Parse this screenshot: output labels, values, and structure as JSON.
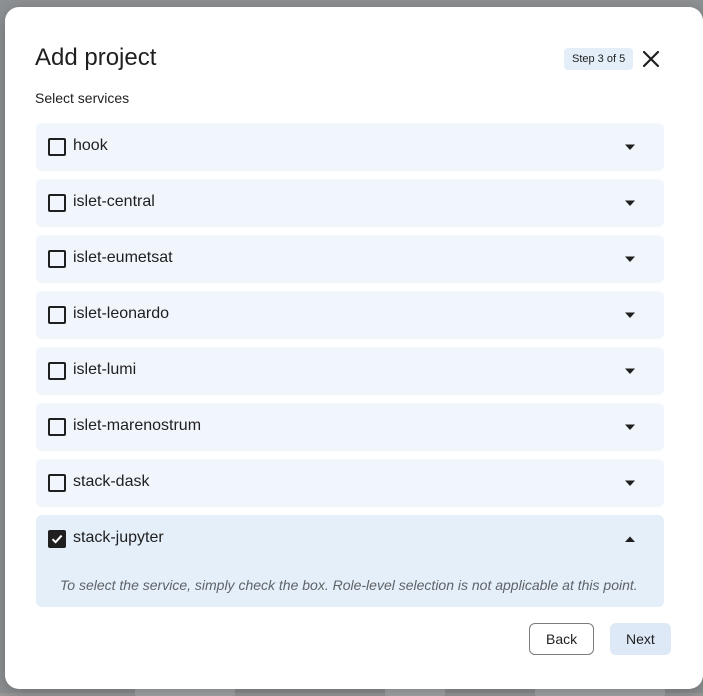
{
  "dialog": {
    "title": "Add project",
    "step": "Step 3 of 5",
    "subtitle": "Select services"
  },
  "services": [
    {
      "label": "hook",
      "checked": false,
      "expanded": false
    },
    {
      "label": "islet-central",
      "checked": false,
      "expanded": false
    },
    {
      "label": "islet-eumetsat",
      "checked": false,
      "expanded": false
    },
    {
      "label": "islet-leonardo",
      "checked": false,
      "expanded": false
    },
    {
      "label": "islet-lumi",
      "checked": false,
      "expanded": false
    },
    {
      "label": "islet-marenostrum",
      "checked": false,
      "expanded": false
    },
    {
      "label": "stack-dask",
      "checked": false,
      "expanded": false
    },
    {
      "label": "stack-jupyter",
      "checked": true,
      "expanded": true,
      "help": "To select the service, simply check the box. Role-level selection is not applicable at this point."
    }
  ],
  "actions": {
    "back_label": "Back",
    "next_label": "Next"
  },
  "icons": {
    "close": "close-icon",
    "expand": "chevron-down-icon",
    "collapse": "chevron-up-icon",
    "check": "checkmark-icon"
  }
}
